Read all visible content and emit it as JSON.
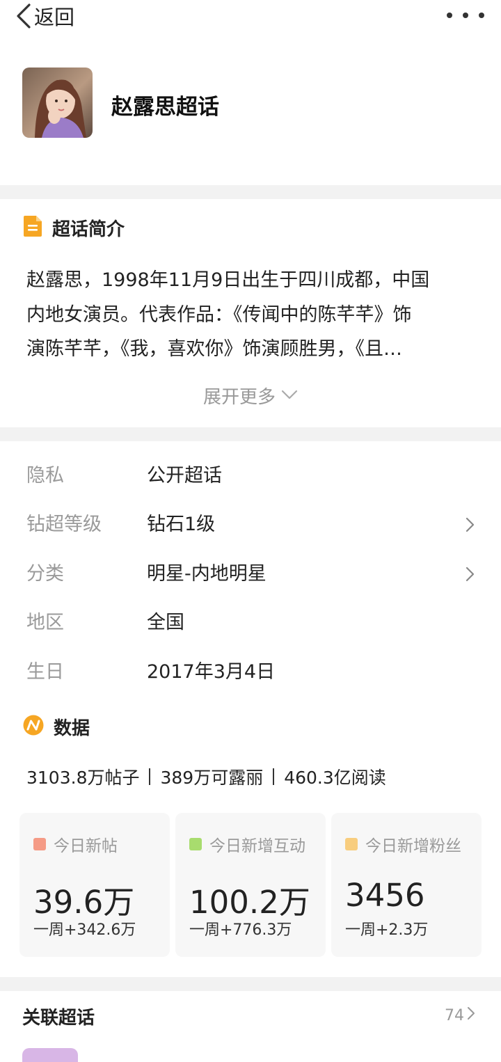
{
  "header": {
    "back_label": "返回",
    "more_icon": "more-horizontal-icon"
  },
  "topic": {
    "title": "赵露思超话"
  },
  "intro": {
    "title": "超话简介",
    "icon": "document-icon",
    "icon_color": "#f6a623",
    "lines": [
      "赵露思，1998年11月9日出生于四川成都，中国",
      "内地女演员。代表作品：《传闻中的陈芊芊》饰",
      "演陈芊芊，《我，喜欢你》饰演顾胜男，《且…"
    ],
    "expand_label": "展开更多"
  },
  "info": {
    "rows": [
      {
        "label": "隐私",
        "value": "公开超话",
        "has_arrow": false
      },
      {
        "label": "钻超等级",
        "value": "钻石1级",
        "has_arrow": true
      },
      {
        "label": "分类",
        "value": "明星-内地明星",
        "has_arrow": true
      },
      {
        "label": "地区",
        "value": "全国",
        "has_arrow": false
      },
      {
        "label": "生日",
        "value": "2017年3月4日",
        "has_arrow": false
      }
    ]
  },
  "stats": {
    "title": "数据",
    "icon": "data-trend-icon",
    "icon_color": "#f6a623",
    "posts": "3103.8万帖子",
    "fans": "389万可露丽",
    "reads": "460.3亿阅读",
    "cards": [
      {
        "label": "今日新帖",
        "value": "39.6万",
        "week": "一周+342.6万",
        "color": "#f59b86"
      },
      {
        "label": "今日新增互动",
        "value": "100.2万",
        "week": "一周+776.3万",
        "color": "#a8dc6e"
      },
      {
        "label": "今日新增粉丝",
        "value": "3456",
        "week": "一周+2.3万",
        "color": "#f8cd7e"
      }
    ]
  },
  "related": {
    "title": "关联超话",
    "count": "74"
  },
  "colors": {
    "divider": "#f2f2f2",
    "label_gray": "#9a9a9a",
    "card_bg": "#f7f7f7"
  }
}
